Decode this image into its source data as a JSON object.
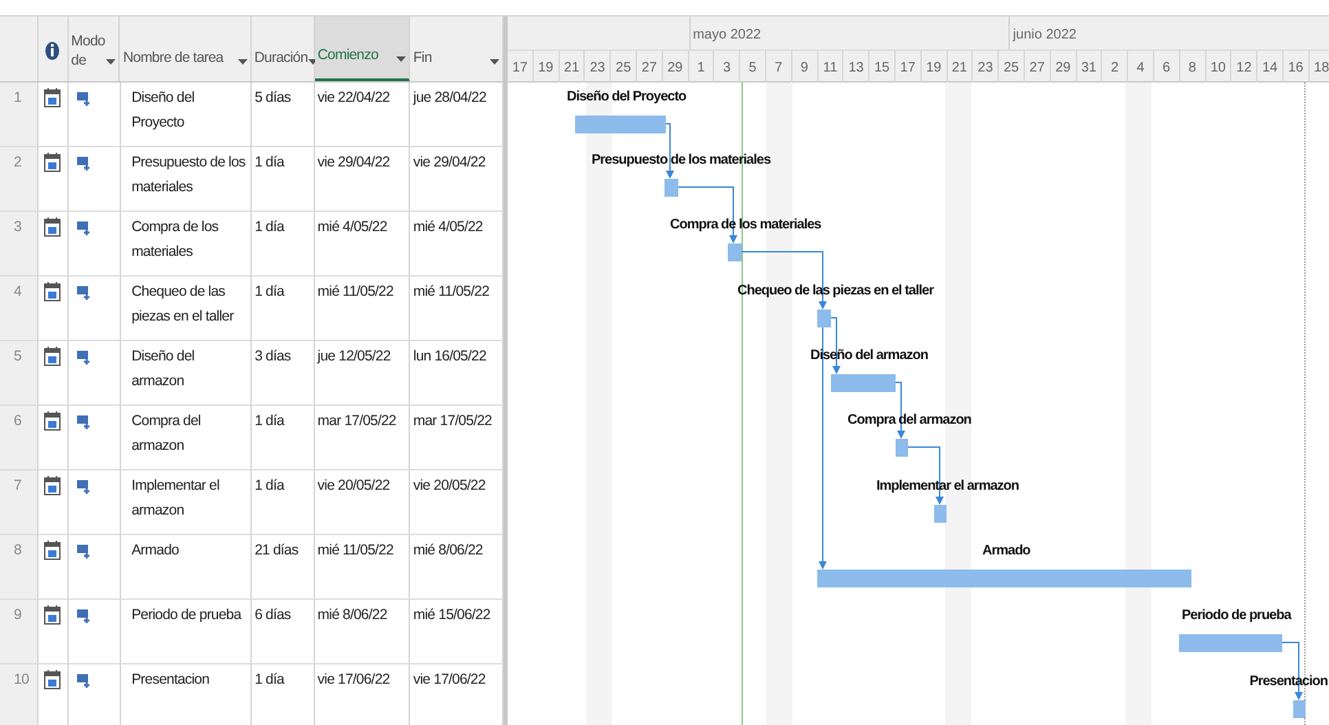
{
  "table": {
    "columns": [
      {
        "label": "Modo de",
        "selected": false
      },
      {
        "label": "Nombre de tarea",
        "selected": false
      },
      {
        "label": "Duración",
        "selected": false
      },
      {
        "label": "Comienzo",
        "selected": true
      },
      {
        "label": "Fin",
        "selected": false
      }
    ],
    "rows": [
      {
        "number": "1",
        "name": "Diseño del Proyecto",
        "duration": "5 días",
        "start": "vie 22/04/22",
        "finish": "jue 28/04/22"
      },
      {
        "number": "2",
        "name": "Presupuesto de los materiales",
        "duration": "1 día",
        "start": "vie 29/04/22",
        "finish": "vie 29/04/22"
      },
      {
        "number": "3",
        "name": "Compra de los materiales",
        "duration": "1 día",
        "start": "mié 4/05/22",
        "finish": "mié 4/05/22"
      },
      {
        "number": "4",
        "name": "Chequeo de las piezas en el taller",
        "duration": "1 día",
        "start": "mié 11/05/22",
        "finish": "mié 11/05/22"
      },
      {
        "number": "5",
        "name": "Diseño del armazon",
        "duration": "3 días",
        "start": "jue 12/05/22",
        "finish": "lun 16/05/22"
      },
      {
        "number": "6",
        "name": "Compra del armazon",
        "duration": "1 día",
        "start": "mar 17/05/22",
        "finish": "mar 17/05/22"
      },
      {
        "number": "7",
        "name": "Implementar el armazon",
        "duration": "1 día",
        "start": "vie 20/05/22",
        "finish": "vie 20/05/22"
      },
      {
        "number": "8",
        "name": "Armado",
        "duration": "21 días",
        "start": "mié 11/05/22",
        "finish": "mié 8/06/22"
      },
      {
        "number": "9",
        "name": "Periodo de prueba",
        "duration": "6 días",
        "start": "mié 8/06/22",
        "finish": "mié 15/06/22"
      },
      {
        "number": "10",
        "name": "Presentacion",
        "duration": "1 día",
        "start": "vie 17/06/22",
        "finish": "vie 17/06/22"
      }
    ]
  },
  "timescale": {
    "months": [
      "mayo 2022",
      "junio 2022"
    ],
    "days": [
      "17",
      "19",
      "21",
      "23",
      "25",
      "27",
      "29",
      "1",
      "3",
      "5",
      "7",
      "9",
      "11",
      "13",
      "15",
      "17",
      "19",
      "21",
      "23",
      "25",
      "27",
      "29",
      "31",
      "2",
      "4",
      "6",
      "8",
      "10",
      "12",
      "14",
      "16",
      "18"
    ]
  },
  "gantt": {
    "bars": [
      {
        "label": "Diseño del Proyecto"
      },
      {
        "label": "Presupuesto de los materiales"
      },
      {
        "label": "Compra de los materiales"
      },
      {
        "label": "Chequeo de las piezas en el taller"
      },
      {
        "label": "Diseño del armazon"
      },
      {
        "label": "Compra del armazon"
      },
      {
        "label": "Implementar el armazon"
      },
      {
        "label": "Armado"
      },
      {
        "label": "Periodo de prueba"
      },
      {
        "label": "Presentacion"
      }
    ]
  }
}
